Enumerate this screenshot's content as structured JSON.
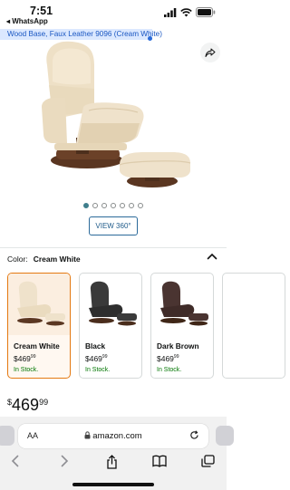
{
  "status": {
    "time": "7:51",
    "back_app": "◂ WhatsApp"
  },
  "product": {
    "title_fragment": "Wood Base, Faux Leather 9096 (Cream White)",
    "carousel_dots": 7,
    "active_dot": 0,
    "view360_label": "VIEW 360°"
  },
  "color": {
    "label": "Color:",
    "selected": "Cream White"
  },
  "swatches": [
    {
      "name": "Cream White",
      "price_dollars": "$469",
      "price_cents": "99",
      "stock": "In Stock.",
      "seat_color": "#efe2cb",
      "base_color": "#5b3722"
    },
    {
      "name": "Black",
      "price_dollars": "$469",
      "price_cents": "99",
      "stock": "In Stock.",
      "seat_color": "#3a3a3a",
      "base_color": "#4a2d1c"
    },
    {
      "name": "Dark Brown",
      "price_dollars": "$469",
      "price_cents": "99",
      "stock": "In Stock.",
      "seat_color": "#4a3431",
      "base_color": "#3f2617"
    },
    {
      "name": "",
      "price_dollars": "",
      "price_cents": "",
      "stock": "",
      "seat_color": "#cfcfcf",
      "base_color": "#cfcfcf"
    }
  ],
  "price": {
    "currency": "$",
    "dollars": "469",
    "cents": "99"
  },
  "browser": {
    "aa_label": "AA",
    "url": "amazon.com",
    "lock_icon": "lock-icon"
  },
  "colors": {
    "accent_orange": "#e47911",
    "link_blue": "#1f5b8a",
    "in_stock_green": "#007600"
  }
}
